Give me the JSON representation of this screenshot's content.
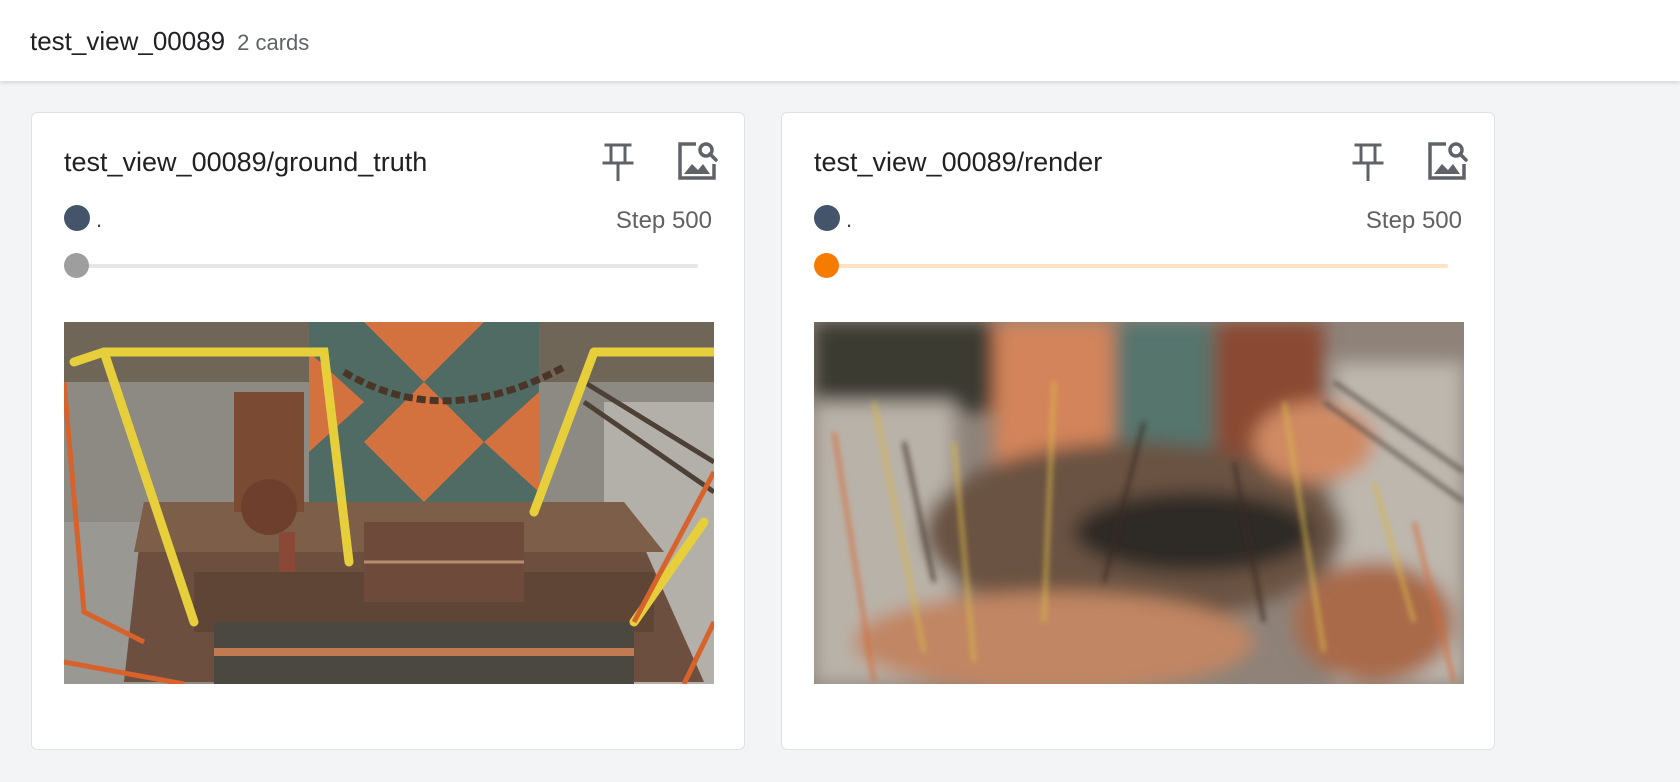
{
  "header": {
    "title": "test_view_00089",
    "count": "2 cards"
  },
  "cards": [
    {
      "title": "test_view_00089/ground_truth",
      "run_name": ".",
      "run_color": "#44546a",
      "step": "Step 500",
      "slider_value": 0,
      "slider_track_color": "#e6e6e6",
      "slider_thumb_color": "#9e9e9e",
      "pin_icon": "pin-icon",
      "zoom_icon": "image-search-icon"
    },
    {
      "title": "test_view_00089/render",
      "run_name": ".",
      "run_color": "#44546a",
      "step": "Step 500",
      "slider_value": 0,
      "slider_track_color": "#fde2c4",
      "slider_thumb_color": "#f57c00",
      "pin_icon": "pin-icon",
      "zoom_icon": "image-search-icon"
    }
  ]
}
